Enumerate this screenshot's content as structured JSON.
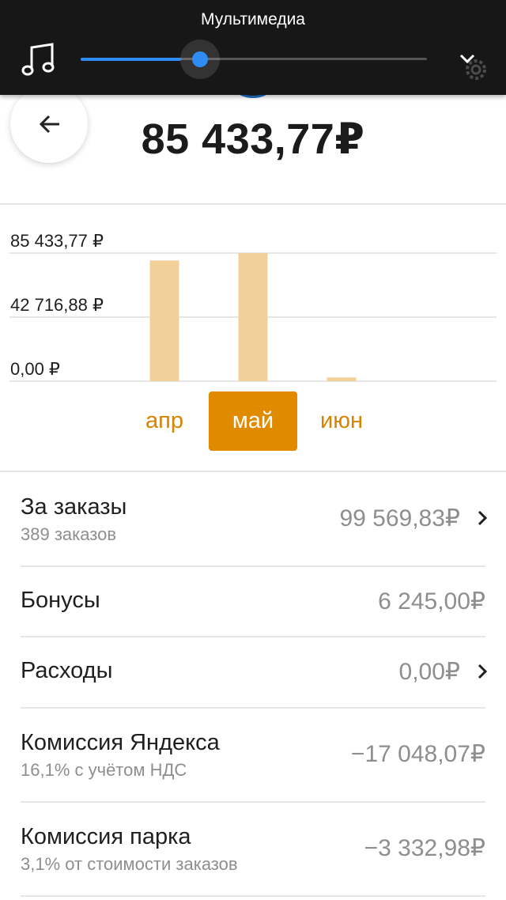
{
  "media": {
    "title": "Мультимедиа",
    "volume_level": 0.29,
    "icons": [
      "music-note-icon",
      "chevron-down-icon",
      "gear-icon"
    ]
  },
  "header": {
    "balance": "85 433,77₽",
    "back_icon": "arrow-left-icon"
  },
  "colors": {
    "accent": "#e08a00",
    "bar": "#f1d09a",
    "slider": "#2f8cf2",
    "muted_text": "#8e8e8e"
  },
  "chart_data": {
    "type": "bar",
    "categories": [
      "апр",
      "май",
      "июн"
    ],
    "values": [
      80500,
      85433.77,
      2500
    ],
    "ylim": [
      0,
      85433.77
    ],
    "y_tick_labels": [
      "85 433,77 ₽",
      "42 716,88 ₽",
      "0,00 ₽"
    ],
    "selected_category": "май",
    "grid": true
  },
  "rows": [
    {
      "title": "За заказы",
      "subtitle": "389 заказов",
      "value": "99 569,83₽",
      "has_arrow": true
    },
    {
      "title": "Бонусы",
      "subtitle": "",
      "value": "6 245,00₽",
      "has_arrow": false
    },
    {
      "title": "Расходы",
      "subtitle": "",
      "value": "0,00₽",
      "has_arrow": true
    },
    {
      "title": "Комиссия Яндекса",
      "subtitle": "16,1% с учётом НДС",
      "value": "−17 048,07₽",
      "has_arrow": false
    },
    {
      "title": "Комиссия парка",
      "subtitle": "3,1% от стоимости заказов",
      "value": "−3 332,98₽",
      "has_arrow": false
    }
  ]
}
